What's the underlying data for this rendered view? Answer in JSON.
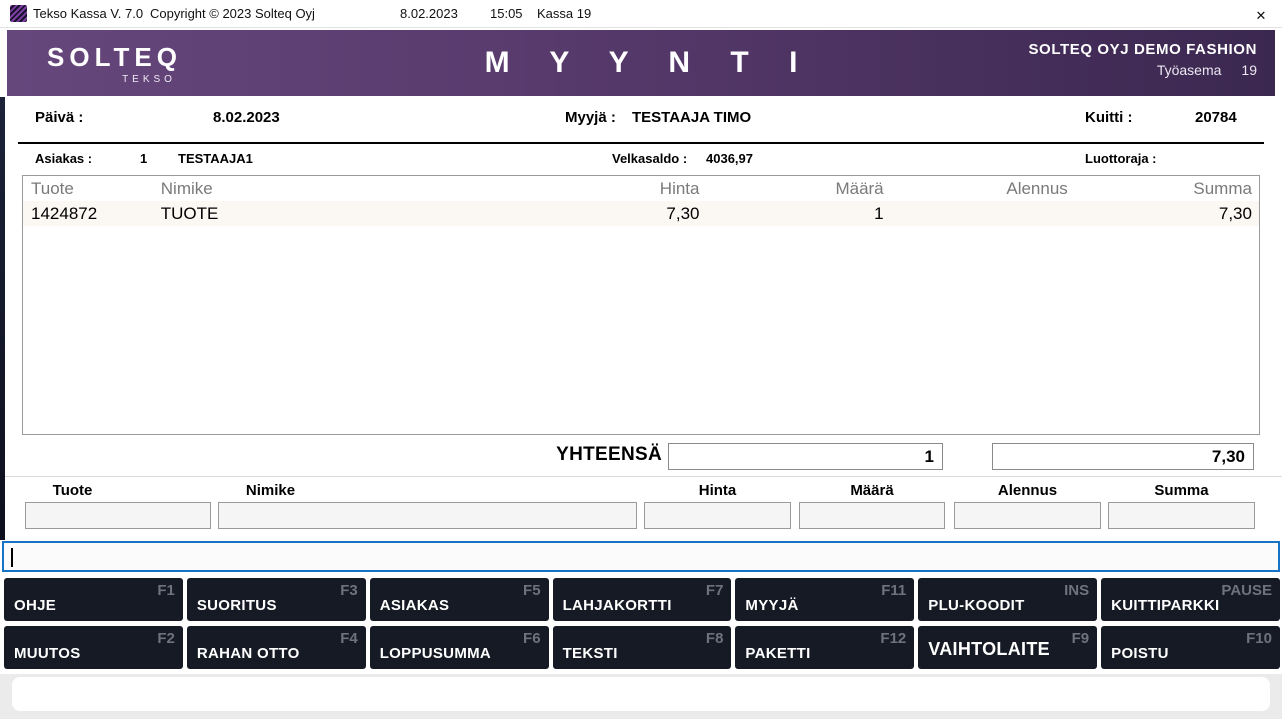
{
  "titlebar": {
    "title": "Tekso Kassa V. 7.0",
    "copyright": "Copyright © 2023 Solteq Oyj",
    "date": "8.02.2023",
    "time": "15:05",
    "register": "Kassa 19",
    "close_glyph": "✕"
  },
  "header": {
    "logo_primary": "SOLTEQ",
    "logo_secondary": "TEKSO",
    "title": "M Y Y N T I",
    "store_name": "SOLTEQ OYJ DEMO FASHION",
    "workstation_label": "Työasema",
    "workstation_number": "19",
    "gradient_left": "#66477c",
    "gradient_right": "#3b2850"
  },
  "info_bar": {
    "date_label": "Päivä :",
    "date_value": "8.02.2023",
    "seller_label": "Myyjä :",
    "seller_value": "TESTAAJA TIMO",
    "receipt_label": "Kuitti :",
    "receipt_value": "20784"
  },
  "customer_bar": {
    "customer_label": "Asiakas :",
    "customer_number": "1",
    "customer_name": "TESTAAJA1",
    "balance_label": "Velkasaldo :",
    "balance_value": "4036,97",
    "credit_label": "Luottoraja :",
    "credit_value": ""
  },
  "sale_table": {
    "columns": [
      "Tuote",
      "Nimike",
      "Hinta",
      "Määrä",
      "Alennus",
      "Summa"
    ],
    "rows": [
      {
        "tuote": "1424872",
        "nimike": "TUOTE",
        "hinta": "7,30",
        "maara": "1",
        "alennus": "",
        "summa": "7,30"
      }
    ]
  },
  "totals": {
    "label": "YHTEENSÄ",
    "quantity": "1",
    "sum": "7,30"
  },
  "entry": {
    "labels": {
      "tuote": "Tuote",
      "nimike": "Nimike",
      "hinta": "Hinta",
      "maara": "Määrä",
      "alennus": "Alennus",
      "summa": "Summa"
    },
    "values": {
      "tuote": "",
      "nimike": "",
      "hinta": "",
      "maara": "",
      "alennus": "",
      "summa": ""
    }
  },
  "command_input": {
    "value": "",
    "accent_color": "#1673c6"
  },
  "function_keys": {
    "button_bg": "#151a24",
    "key_color": "#6d727d",
    "row1": [
      {
        "label": "OHJE",
        "key": "F1"
      },
      {
        "label": "SUORITUS",
        "key": "F3"
      },
      {
        "label": "ASIAKAS",
        "key": "F5"
      },
      {
        "label": "LAHJAKORTTI",
        "key": "F7"
      },
      {
        "label": "MYYJÄ",
        "key": "F11"
      },
      {
        "label": "PLU-KOODIT",
        "key": "INS"
      },
      {
        "label": "KUITTIPARKKI",
        "key": "PAUSE"
      }
    ],
    "row2": [
      {
        "label": "MUUTOS",
        "key": "F2"
      },
      {
        "label": "RAHAN OTTO",
        "key": "F4"
      },
      {
        "label": "LOPPUSUMMA",
        "key": "F6"
      },
      {
        "label": "TEKSTI",
        "key": "F8"
      },
      {
        "label": "PAKETTI",
        "key": "F12"
      },
      {
        "label": "VAIHTOLAITE",
        "key": "F9"
      },
      {
        "label": "POISTU",
        "key": "F10"
      }
    ]
  }
}
